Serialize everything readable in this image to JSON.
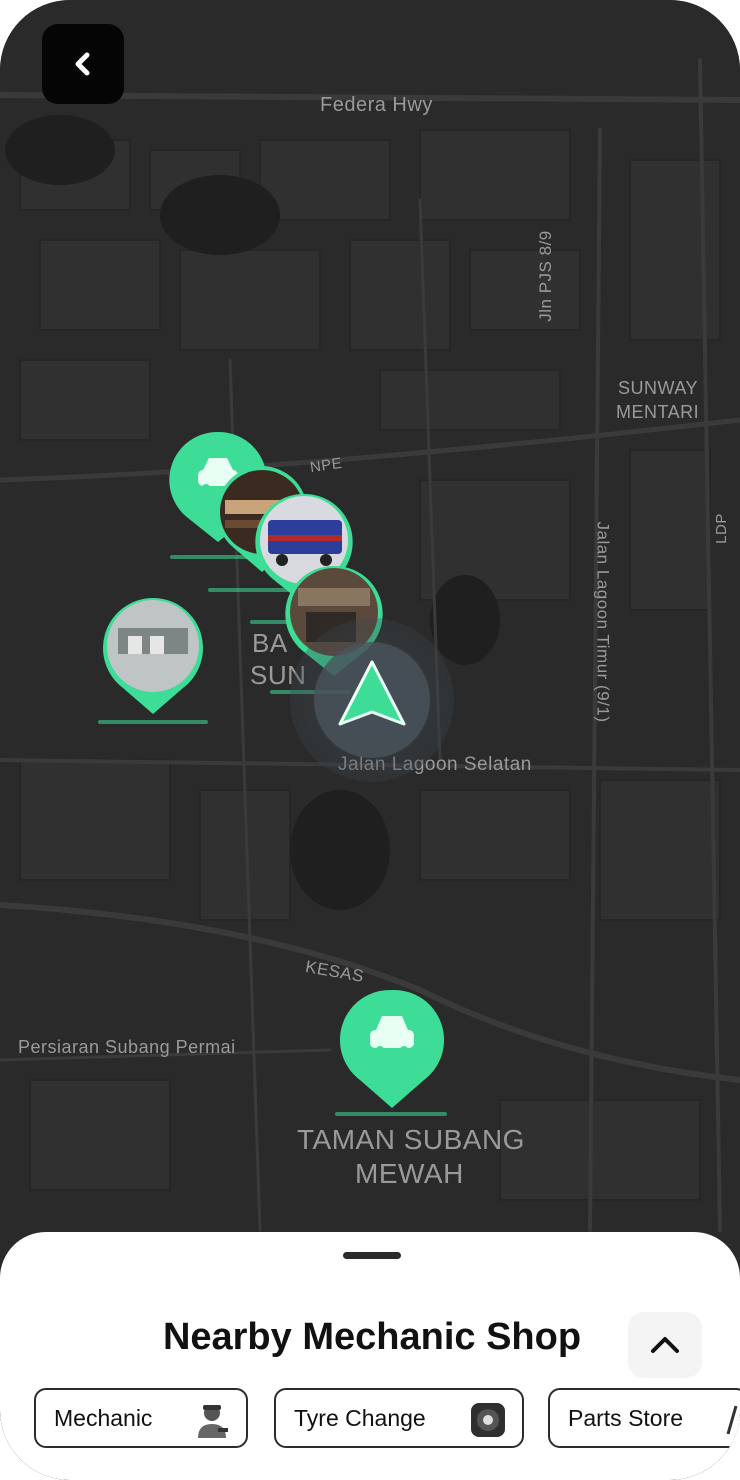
{
  "map": {
    "labels": {
      "federal_hwy": "Federa Hwy",
      "jln_pjs": "Jln PJS 8/9",
      "sunway_mentari_1": "SUNWAY",
      "sunway_mentari_2": "MENTARI",
      "npe": "NPE",
      "ldp": "LDP",
      "jalan_lagoon_timur": "Jalan Lagoon Timur (9/1)",
      "bandar_sunway_1": "BA",
      "bandar_sunway_2": "SUN",
      "jalan_lagoon_selatan": "Jalan Lagoon Selatan",
      "kesas": "KESAS",
      "persiaran": "Persiaran Subang Permai",
      "taman_1": "TAMAN SUBANG",
      "taman_2": "MEWAH"
    },
    "pins": [
      {
        "name": "mechanic-pin-car-1",
        "kind": "car-icon"
      },
      {
        "name": "mechanic-pin-photo-1",
        "kind": "shop-photo"
      },
      {
        "name": "mechanic-pin-photo-2",
        "kind": "shop-photo"
      },
      {
        "name": "mechanic-pin-photo-3",
        "kind": "shop-photo"
      },
      {
        "name": "mechanic-pin-photo-4",
        "kind": "shop-photo"
      },
      {
        "name": "mechanic-pin-car-2",
        "kind": "car-icon"
      }
    ],
    "accent": "#3ddc97"
  },
  "sheet": {
    "title": "Nearby Mechanic Shop",
    "categories": [
      {
        "label": "Mechanic",
        "icon": "mechanic-person-icon"
      },
      {
        "label": "Tyre Change",
        "icon": "tyre-icon"
      },
      {
        "label": "Parts Store",
        "icon": "parts-icon"
      }
    ]
  }
}
